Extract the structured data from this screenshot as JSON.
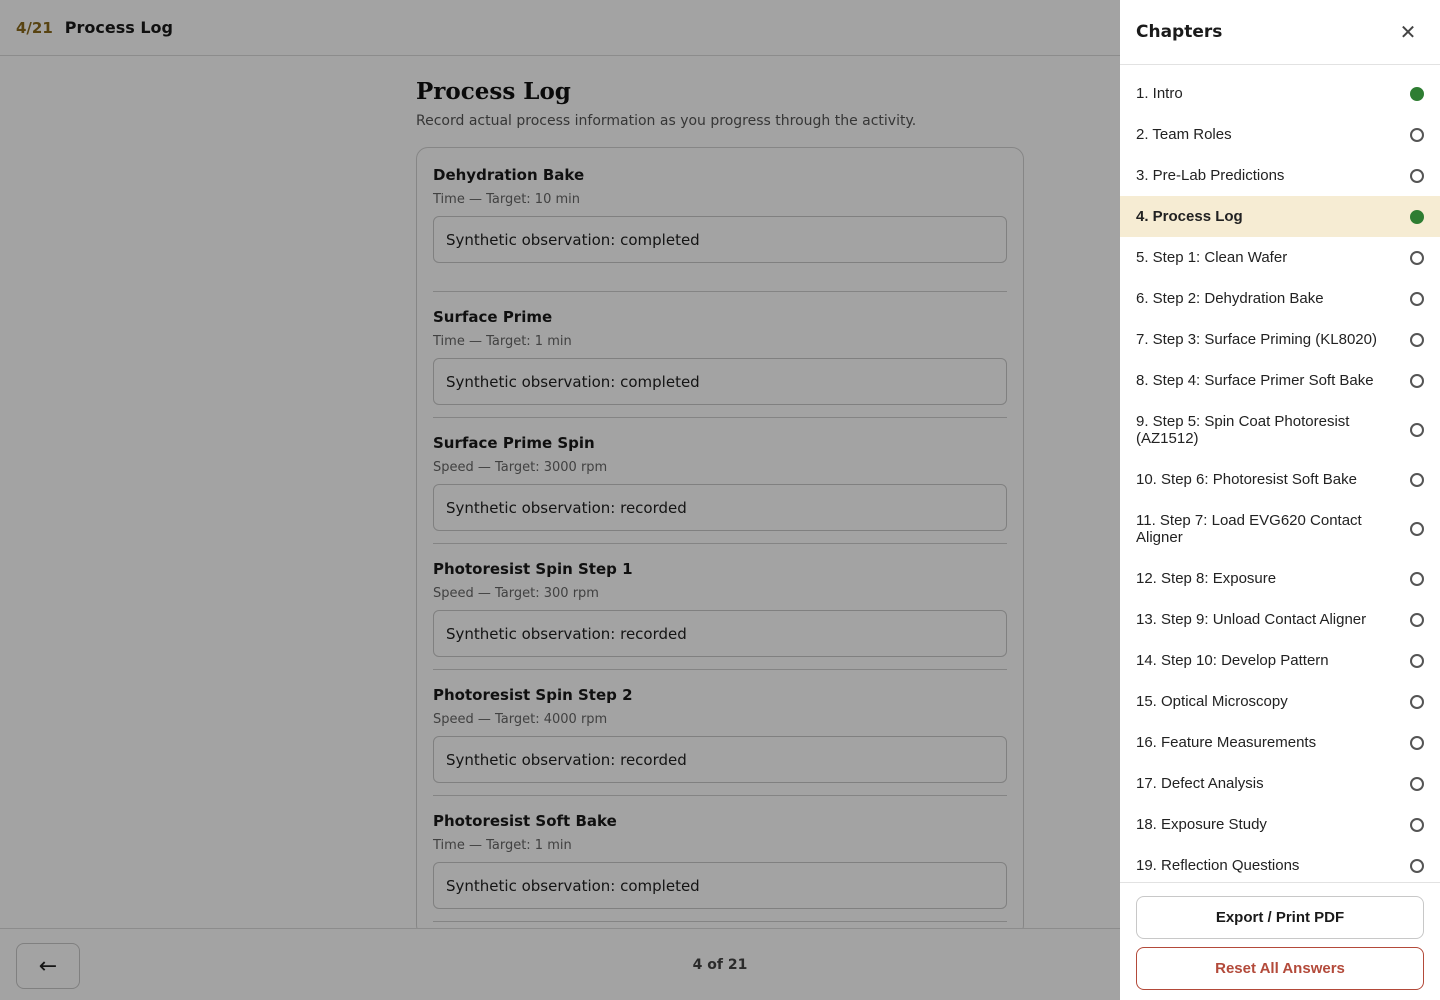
{
  "topbar": {
    "counter": "4/21",
    "title": "Process Log"
  },
  "main": {
    "title": "Process Log",
    "description": "Record actual process information as you progress through the activity.",
    "entries": [
      {
        "name": "Dehydration Bake",
        "sub": "Time — Target: 10 min",
        "value": "Synthetic observation: completed"
      },
      {
        "name": "Surface Prime",
        "sub": "Time — Target: 1 min",
        "value": "Synthetic observation: completed"
      },
      {
        "name": "Surface Prime Spin",
        "sub": "Speed — Target: 3000 rpm",
        "value": "Synthetic observation: recorded"
      },
      {
        "name": "Photoresist Spin Step 1",
        "sub": "Speed — Target: 300 rpm",
        "value": "Synthetic observation: recorded"
      },
      {
        "name": "Photoresist Spin Step 2",
        "sub": "Speed — Target: 4000 rpm",
        "value": "Synthetic observation: recorded"
      },
      {
        "name": "Photoresist Soft Bake",
        "sub": "Time — Target: 1 min",
        "value": "Synthetic observation: completed"
      }
    ]
  },
  "footer": {
    "back_icon": "←",
    "pager": "4 of 21"
  },
  "drawer": {
    "title": "Chapters",
    "close_icon": "✕",
    "chapters": [
      {
        "label": "1. Intro",
        "status": "complete"
      },
      {
        "label": "2. Team Roles",
        "status": "incomplete"
      },
      {
        "label": "3. Pre-Lab Predictions",
        "status": "incomplete"
      },
      {
        "label": "4. Process Log",
        "status": "complete",
        "active": true
      },
      {
        "label": "5. Step 1: Clean Wafer",
        "status": "incomplete"
      },
      {
        "label": "6. Step 2: Dehydration Bake",
        "status": "incomplete"
      },
      {
        "label": "7. Step 3: Surface Priming (KL8020)",
        "status": "incomplete"
      },
      {
        "label": "8. Step 4: Surface Primer Soft Bake",
        "status": "incomplete"
      },
      {
        "label": "9. Step 5: Spin Coat Photoresist (AZ1512)",
        "status": "incomplete"
      },
      {
        "label": "10. Step 6: Photoresist Soft Bake",
        "status": "incomplete"
      },
      {
        "label": "11. Step 7: Load EVG620 Contact Aligner",
        "status": "incomplete"
      },
      {
        "label": "12. Step 8: Exposure",
        "status": "incomplete"
      },
      {
        "label": "13. Step 9: Unload Contact Aligner",
        "status": "incomplete"
      },
      {
        "label": "14. Step 10: Develop Pattern",
        "status": "incomplete"
      },
      {
        "label": "15. Optical Microscopy",
        "status": "incomplete"
      },
      {
        "label": "16. Feature Measurements",
        "status": "incomplete"
      },
      {
        "label": "17. Defect Analysis",
        "status": "incomplete"
      },
      {
        "label": "18. Exposure Study",
        "status": "incomplete"
      },
      {
        "label": "19. Reflection Questions",
        "status": "incomplete"
      }
    ],
    "export_label": "Export / Print PDF",
    "reset_label": "Reset All Answers",
    "colors": {
      "complete": "#2e7d32",
      "active_bg": "#f6ecd3",
      "danger": "#b34a3a",
      "accent": "#8a6a1c"
    }
  }
}
